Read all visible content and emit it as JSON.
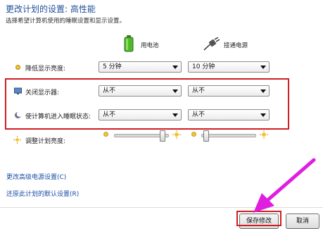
{
  "header": {
    "title": "更改计划的设置: 高性能",
    "subtitle": "选择希望计算机使用的睡眠设置和显示设置。"
  },
  "columns": {
    "battery_label": "用电池",
    "plugged_label": "接通电源"
  },
  "rows": [
    {
      "label": "降低显示亮度:",
      "icon": "dim-display-icon",
      "battery": "5 分钟",
      "plugged": "10 分钟"
    },
    {
      "label": "关闭显示器:",
      "icon": "monitor-icon",
      "battery": "从不",
      "plugged": "从不"
    },
    {
      "label": "使计算机进入睡眠状态:",
      "icon": "moon-sleep-icon",
      "battery": "从不",
      "plugged": "从不"
    }
  ],
  "brightness": {
    "label": "调整计划亮度:",
    "battery_level": 0.95,
    "plugged_level": 0.05
  },
  "links": {
    "advanced": "更改高级电源设置(C)",
    "restore": "还原此计划的默认设置(R)"
  },
  "buttons": {
    "save": "保存修改",
    "cancel": "取消"
  },
  "colors": {
    "highlight_red": "#d21d21",
    "arrow_magenta": "#e01ee0",
    "title_blue": "#1f4e9a",
    "link_blue": "#1a4ea8"
  }
}
